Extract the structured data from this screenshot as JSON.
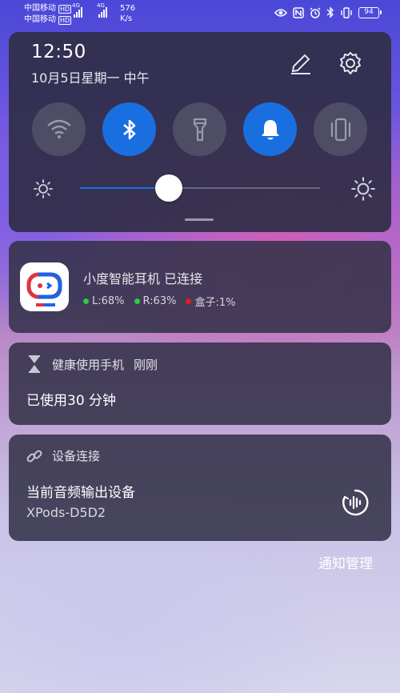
{
  "status_bar": {
    "carrier1": "中国移动",
    "carrier2": "中国移动",
    "hd_label": "HD",
    "net_type": "4G",
    "speed_value": "576",
    "speed_unit": "K/s",
    "battery": "94",
    "icons": [
      "eye-icon",
      "nfc-icon",
      "alarm-icon",
      "bluetooth-icon",
      "vibrate-icon",
      "battery-icon"
    ]
  },
  "quick_settings": {
    "time": "12:50",
    "date": "10月5日星期一 中午",
    "toggles": [
      {
        "name": "wifi",
        "icon": "wifi-icon",
        "on": false
      },
      {
        "name": "bluetooth",
        "icon": "bluetooth-icon",
        "on": true
      },
      {
        "name": "flashlight",
        "icon": "flashlight-icon",
        "on": false
      },
      {
        "name": "sound",
        "icon": "bell-icon",
        "on": true
      },
      {
        "name": "vibrate",
        "icon": "vibrate-icon",
        "on": false
      }
    ],
    "brightness_level": 0.37,
    "accent_color": "#1a6fe0"
  },
  "notifications": {
    "earbuds": {
      "title": "小度智能耳机 已连接",
      "left": "L:68%",
      "right": "R:63%",
      "case": "盒子:1%",
      "left_color": "#2ecc40",
      "right_color": "#2ecc40",
      "case_color": "#e02020"
    },
    "health": {
      "app_name": "健康使用手机",
      "time": "刚刚",
      "body": "已使用30 分钟"
    },
    "device": {
      "app_name": "设备连接",
      "title": "当前音频输出设备",
      "device_name": "XPods-D5D2"
    }
  },
  "footer": {
    "manage_label": "通知管理"
  }
}
